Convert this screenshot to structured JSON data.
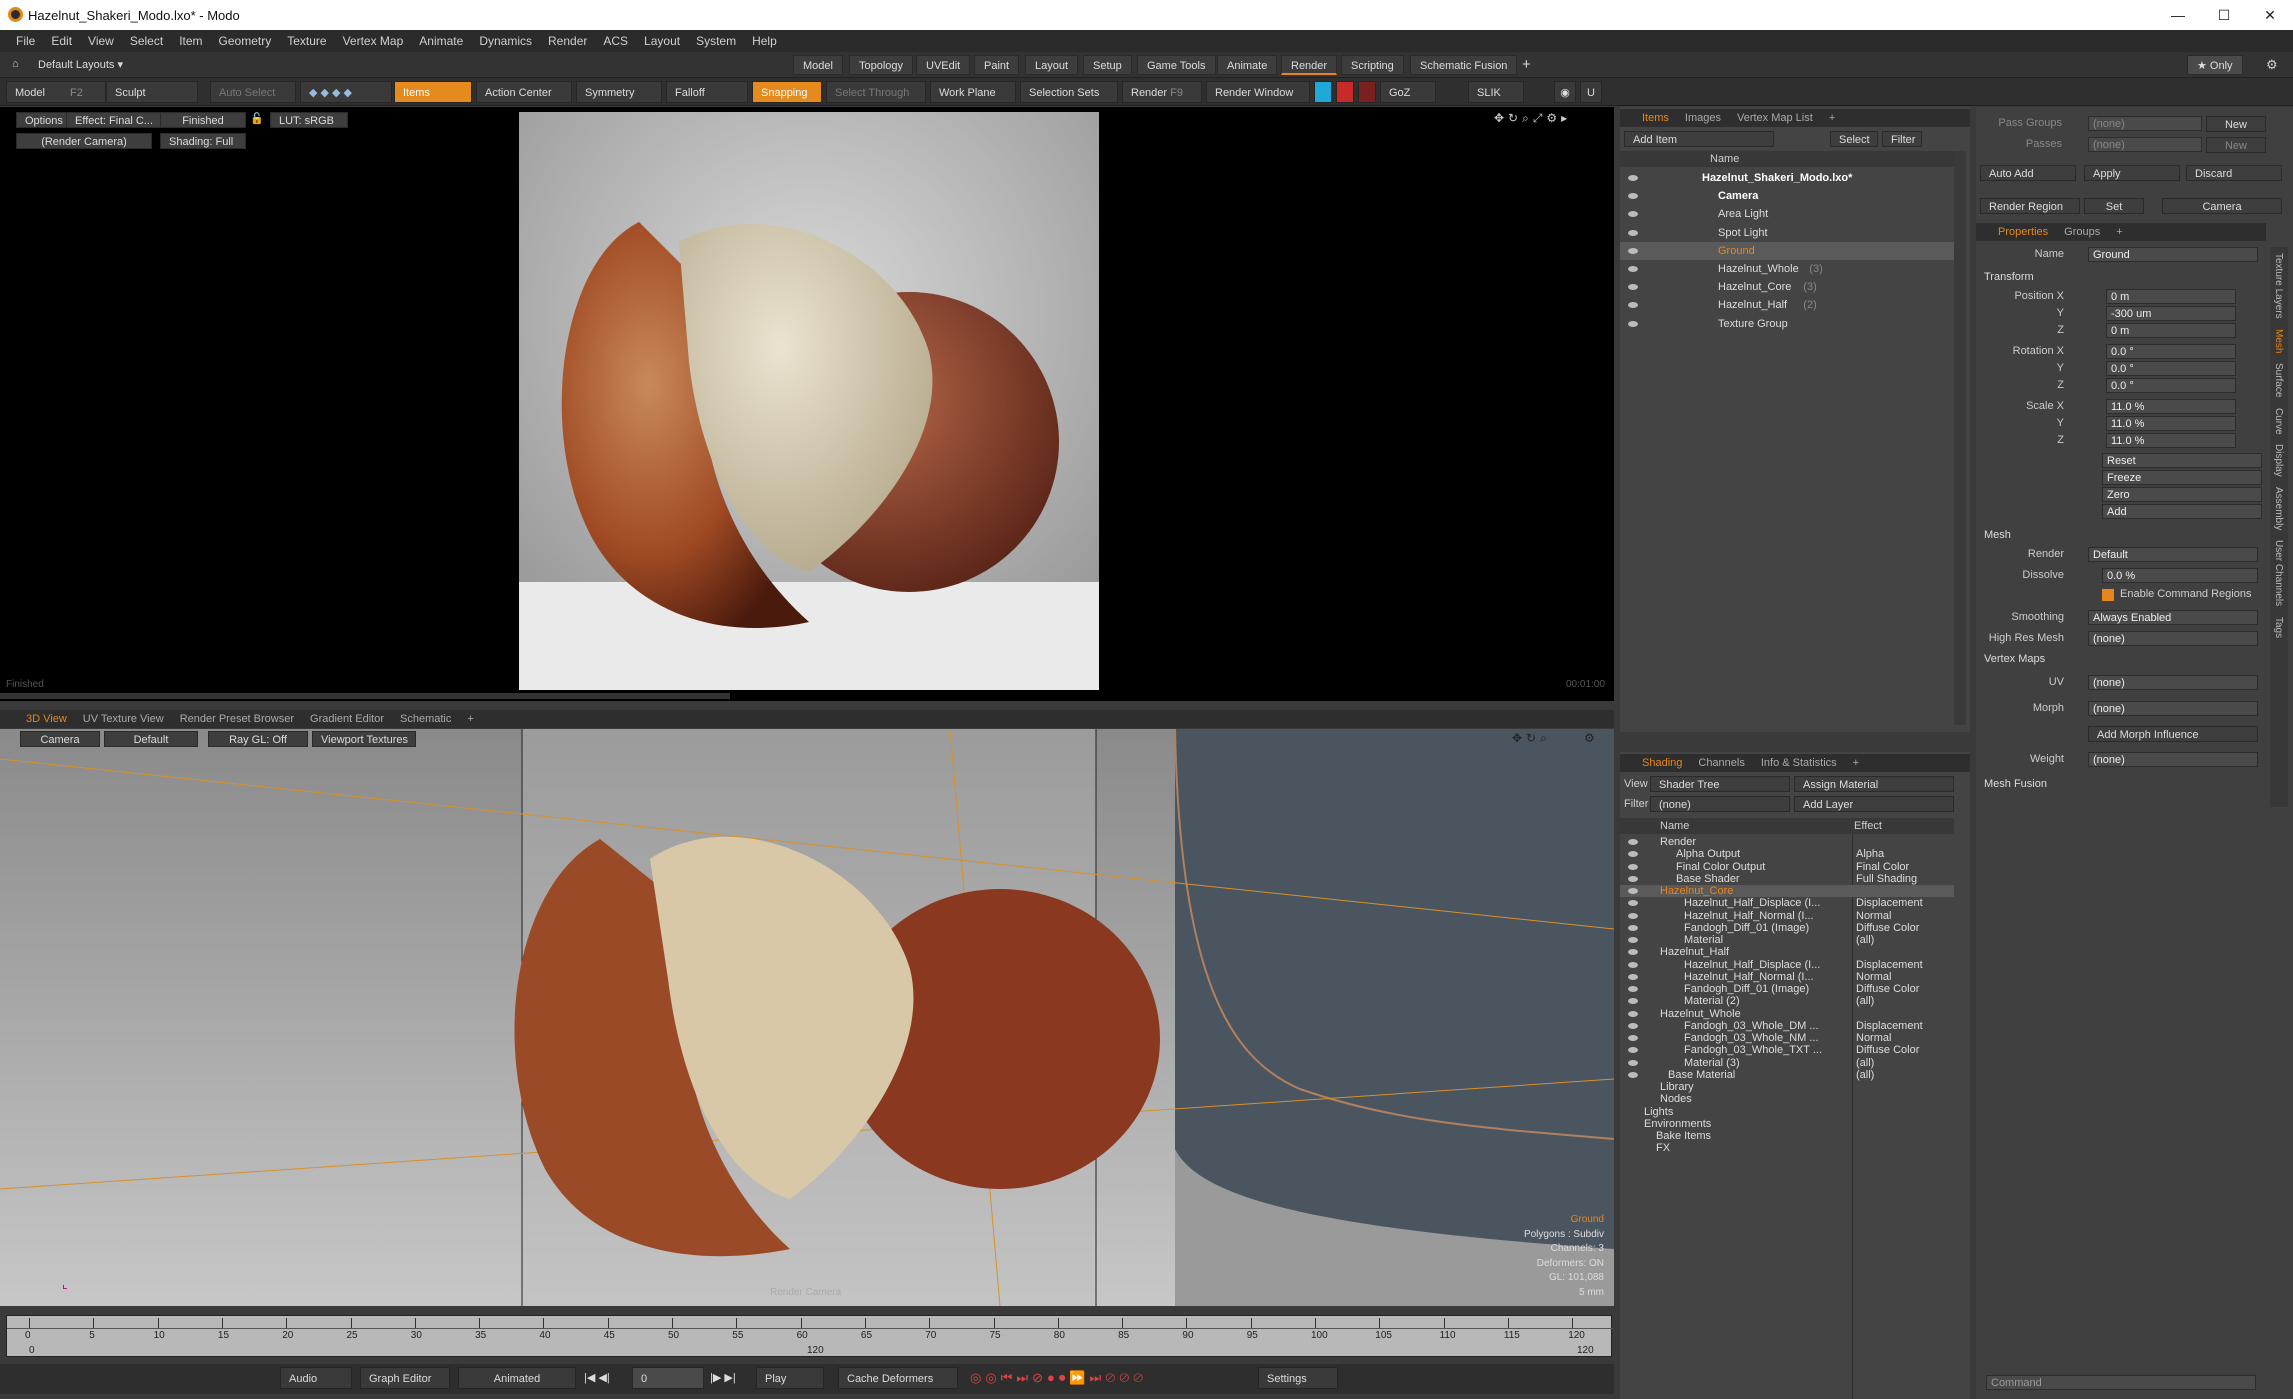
{
  "window": {
    "title": "Hazelnut_Shakeri_Modo.lxo* - Modo",
    "min": "—",
    "max": "☐",
    "close": "✕"
  },
  "menu": [
    "File",
    "Edit",
    "View",
    "Select",
    "Item",
    "Geometry",
    "Texture",
    "Vertex Map",
    "Animate",
    "Dynamics",
    "Render",
    "ACS",
    "Layout",
    "System",
    "Help"
  ],
  "layouts": {
    "default": "Default Layouts ▾",
    "tabs": [
      "Model",
      "Topology",
      "UVEdit",
      "Paint",
      "Layout",
      "Setup",
      "Game Tools",
      "Animate",
      "Render",
      "Scripting",
      "Schematic Fusion"
    ],
    "plus": "+",
    "only": "★ Only"
  },
  "toolbar": {
    "model": "Model",
    "model_key": "F2",
    "sculpt": "Sculpt",
    "auto_select": "Auto Select",
    "items": "Items",
    "action_center": "Action Center",
    "symmetry": "Symmetry",
    "falloff": "Falloff",
    "snapping": "Snapping",
    "select_through": "Select Through",
    "work_plane": "Work Plane",
    "selection_sets": "Selection Sets",
    "render": "Render",
    "render_key": "F9",
    "render_window": "Render Window",
    "goz": "GoZ",
    "slik": "SLIK"
  },
  "render_view": {
    "options": "Options",
    "effect": "Effect: Final C...",
    "finished": "Finished",
    "lut": "LUT: sRGB",
    "camera": "(Render Camera)",
    "shading": "Shading: Full",
    "status": "Finished",
    "time": "00:01:00"
  },
  "view3d": {
    "tabs": [
      "3D View",
      "UV Texture View",
      "Render Preset Browser",
      "Gradient Editor",
      "Schematic"
    ],
    "plus": "+",
    "camera": "Camera",
    "default": "Default",
    "raygl": "Ray GL: Off",
    "viewport_textures": "Viewport Textures",
    "info": [
      "Ground",
      "Polygons : Subdiv",
      "Channels: 3",
      "Deformers: ON",
      "GL: 101,088",
      "5 mm"
    ],
    "cam_label": "Render Camera"
  },
  "timeline": {
    "ticks": [
      "0",
      "5",
      "10",
      "15",
      "20",
      "25",
      "30",
      "35",
      "40",
      "45",
      "50",
      "55",
      "60",
      "65",
      "70",
      "75",
      "80",
      "85",
      "90",
      "95",
      "100",
      "105",
      "110",
      "115",
      "120"
    ],
    "bottom_left": "0",
    "bottom_mid": "120",
    "bottom_right": "120"
  },
  "transport": {
    "audio": "Audio",
    "graph_editor": "Graph Editor",
    "animated": "Animated",
    "frame": "0",
    "play": "Play",
    "cache": "Cache Deformers",
    "settings": "Settings"
  },
  "items_panel": {
    "tabs": [
      "Items",
      "Images",
      "Vertex Map List"
    ],
    "plus": "+",
    "add_item": "Add Item",
    "select": "Select",
    "filter": "Filter",
    "col_name": "Name",
    "rows": [
      {
        "name": "Hazelnut_Shakeri_Modo.lxo*",
        "count": ""
      },
      {
        "name": "Camera",
        "count": ""
      },
      {
        "name": "Area Light",
        "count": ""
      },
      {
        "name": "Spot Light",
        "count": ""
      },
      {
        "name": "Ground",
        "count": ""
      },
      {
        "name": "Hazelnut_Whole",
        "count": "(3)"
      },
      {
        "name": "Hazelnut_Core",
        "count": "(3)"
      },
      {
        "name": "Hazelnut_Half",
        "count": "(2)"
      },
      {
        "name": "Texture Group",
        "count": ""
      }
    ]
  },
  "shading_panel": {
    "tabs": [
      "Shading",
      "Channels",
      "Info & Statistics"
    ],
    "plus": "+",
    "view_label": "View",
    "view_value": "Shader Tree",
    "assign": "Assign Material",
    "filter_label": "Filter",
    "filter_value": "(none)",
    "add_layer": "Add Layer",
    "col_name": "Name",
    "col_effect": "Effect",
    "rows": [
      {
        "name": "Render",
        "effect": ""
      },
      {
        "name": "Alpha Output",
        "effect": "Alpha"
      },
      {
        "name": "Final Color Output",
        "effect": "Final Color"
      },
      {
        "name": "Base Shader",
        "effect": "Full Shading"
      },
      {
        "name": "Hazelnut_Core",
        "effect": ""
      },
      {
        "name": "Hazelnut_Half_Displace (I...",
        "effect": "Displacement"
      },
      {
        "name": "Hazelnut_Half_Normal (I...",
        "effect": "Normal"
      },
      {
        "name": "Fandogh_Diff_01 (Image)",
        "effect": "Diffuse Color"
      },
      {
        "name": "Material",
        "effect": "(all)"
      },
      {
        "name": "Hazelnut_Half",
        "effect": ""
      },
      {
        "name": "Hazelnut_Half_Displace (I...",
        "effect": "Displacement"
      },
      {
        "name": "Hazelnut_Half_Normal (I...",
        "effect": "Normal"
      },
      {
        "name": "Fandogh_Diff_01 (Image)",
        "effect": "Diffuse Color"
      },
      {
        "name": "Material (2)",
        "effect": "(all)"
      },
      {
        "name": "Hazelnut_Whole",
        "effect": ""
      },
      {
        "name": "Fandogh_03_Whole_DM ...",
        "effect": "Displacement"
      },
      {
        "name": "Fandogh_03_Whole_NM ...",
        "effect": "Normal"
      },
      {
        "name": "Fandogh_03_Whole_TXT ...",
        "effect": "Diffuse Color"
      },
      {
        "name": "Material (3)",
        "effect": "(all)"
      },
      {
        "name": "Base Material",
        "effect": "(all)"
      },
      {
        "name": "Library",
        "effect": ""
      },
      {
        "name": "Nodes",
        "effect": ""
      },
      {
        "name": "Lights",
        "effect": ""
      },
      {
        "name": "Environments",
        "effect": ""
      },
      {
        "name": "Bake Items",
        "effect": ""
      },
      {
        "name": "FX",
        "effect": ""
      }
    ]
  },
  "props": {
    "pass_groups": "Pass Groups",
    "passes": "Passes",
    "none": "(none)",
    "new": "New",
    "auto_add": "Auto Add",
    "apply": "Apply",
    "discard": "Discard",
    "render_region": "Render Region",
    "set": "Set",
    "camera": "Camera",
    "tabs": [
      "Properties",
      "Groups"
    ],
    "plus": "+",
    "name_label": "Name",
    "name_value": "Ground",
    "transform": "Transform",
    "pos_label": "Position X",
    "px": "0 m",
    "py": "-300 um",
    "pz": "0 m",
    "rot_label": "Rotation X",
    "rx": "0.0 °",
    "ry": "0.0 °",
    "rz": "0.0 °",
    "scale_label": "Scale X",
    "sx": "11.0 %",
    "sy": "11.0 %",
    "sz": "11.0 %",
    "y": "Y",
    "z": "Z",
    "reset": "Reset",
    "freeze": "Freeze",
    "zero": "Zero",
    "add": "Add",
    "mesh": "Mesh",
    "render_label": "Render",
    "render_value": "Default",
    "dissolve_label": "Dissolve",
    "dissolve_value": "0.0 %",
    "enable_cmd": "Enable Command Regions",
    "smoothing_label": "Smoothing",
    "smoothing_value": "Always Enabled",
    "highres_label": "High Res Mesh",
    "highres_value": "(none)",
    "vertex_maps": "Vertex Maps",
    "uv_label": "UV",
    "uv_value": "(none)",
    "morph_label": "Morph",
    "morph_value": "(none)",
    "add_morph": "Add Morph Influence",
    "weight_label": "Weight",
    "weight_value": "(none)",
    "mesh_fusion": "Mesh Fusion",
    "side_tabs": [
      "Texture Layers",
      "Mesh",
      "Surface",
      "Curve",
      "Display",
      "Assembly",
      "User Channels",
      "Tags"
    ],
    "command": "Command"
  },
  "colors": {
    "accent": "#e8851b",
    "bg": "#3a3a3a"
  }
}
